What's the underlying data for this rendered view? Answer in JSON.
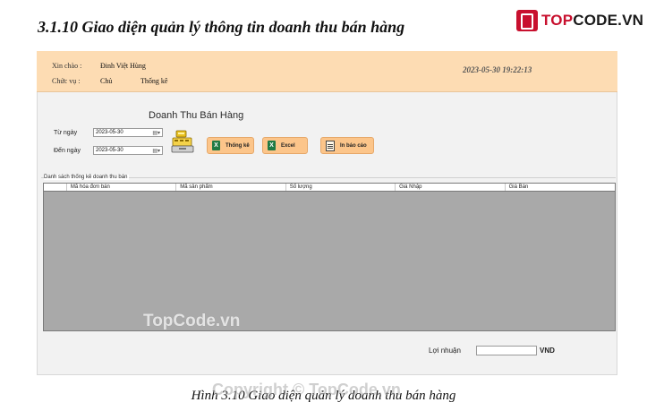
{
  "document": {
    "heading": "3.1.10 Giao diện quản lý thông tin doanh thu bán hàng",
    "caption": "Hình 3.10 Giao diện quản lý doanh thu bán hàng"
  },
  "logo": {
    "text_prefix": "TOP",
    "text_suffix": "CODE.VN",
    "color": "#c8102e"
  },
  "watermarks": {
    "center": "TopCode.vn",
    "bottom": "Copyright © TopCode.vn"
  },
  "header": {
    "greeting_label": "Xin chào :",
    "user_name": "Đinh Việt Hùng",
    "role_label": "Chức vụ :",
    "role_value": "Chủ",
    "nav_stats": "Thống kê",
    "datetime": "2023-05-30 19:22:13",
    "background": "#fddcb3"
  },
  "form": {
    "title": "Doanh Thu Bán Hàng",
    "from_label": "Từ ngày",
    "from_value": "2023-05-30",
    "to_label": "Đến ngày",
    "to_value": "2023-05-30",
    "money_icon": "cash-register-icon",
    "buttons": {
      "stats": "Thống kê",
      "excel": "Excel",
      "print": "In báo cáo"
    },
    "button_color": "#fcc58a"
  },
  "table": {
    "group_title": "Danh sách thống kê doanh thu bán",
    "columns": [
      "Mã hóa đơn bán",
      "Mã sản phẩm",
      "Số lượng",
      "Giá Nhập",
      "Giá Bán"
    ],
    "rows": []
  },
  "profit": {
    "label": "Lợi nhuận",
    "value": "",
    "unit": "VND"
  }
}
